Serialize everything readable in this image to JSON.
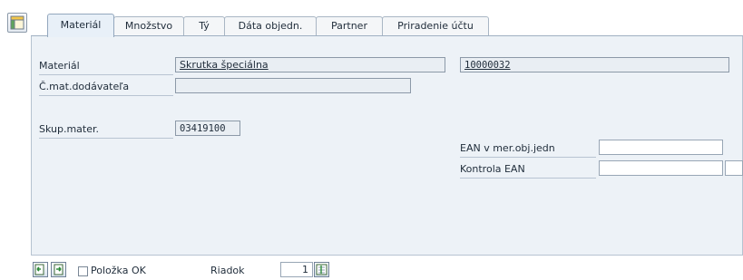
{
  "corner": {
    "icon": "layout-settings-icon"
  },
  "tabs": [
    {
      "label": "Materiál",
      "active": true
    },
    {
      "label": "Množstvo",
      "active": false
    },
    {
      "label": "Tý",
      "active": false
    },
    {
      "label": "Dáta objedn.",
      "active": false
    },
    {
      "label": "Partner",
      "active": false
    },
    {
      "label": "Priradenie účtu",
      "active": false
    }
  ],
  "form": {
    "material_label": "Materiál",
    "material_desc": "Skrutka špeciálna",
    "material_number": "10000032",
    "vendor_mat_label": "Č.mat.dodávateľa",
    "vendor_mat_value": "",
    "mat_group_label": "Skup.mater.",
    "mat_group_value": "03419100",
    "ean_label": "EAN v mer.obj.jedn",
    "ean_value": "",
    "ean_check_label": "Kontrola EAN",
    "ean_check_value": "",
    "ean_check_value2": ""
  },
  "bottom": {
    "item_ok_label": "Položka OK",
    "item_ok_checked": false,
    "row_label": "Riadok",
    "row_value": "1"
  }
}
